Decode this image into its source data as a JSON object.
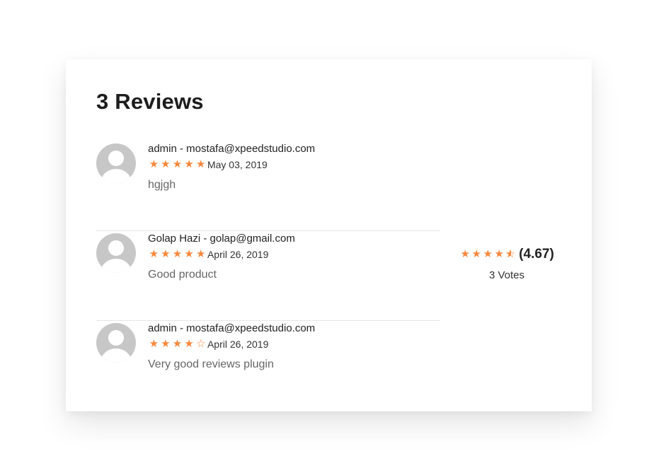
{
  "section": {
    "title": "3 Reviews"
  },
  "reviews": [
    {
      "author": "admin - mostafa@xpeedstudio.com",
      "stars": [
        "★",
        "★",
        "★",
        "★",
        "★"
      ],
      "rating": 5,
      "date": "May 03, 2019",
      "text": "hgjgh"
    },
    {
      "author": "Golap Hazi - golap@gmail.com",
      "stars": [
        "★",
        "★",
        "★",
        "★",
        "★"
      ],
      "rating": 5,
      "date": "April 26, 2019",
      "text": "Good product"
    },
    {
      "author": "admin - mostafa@xpeedstudio.com",
      "stars": [
        "★",
        "★",
        "★",
        "★",
        "☆"
      ],
      "rating": 4,
      "date": "April 26, 2019",
      "text": "Very good reviews plugin"
    }
  ],
  "summary": {
    "stars": [
      "★",
      "★",
      "★",
      "★"
    ],
    "half_star_fill": "★",
    "half_star_empty": "☆",
    "rating": 4.67,
    "average": "(4.67)",
    "votes": "3 Votes"
  },
  "colors": {
    "star": "#f7873b",
    "avatar": "#c7c7c7"
  }
}
